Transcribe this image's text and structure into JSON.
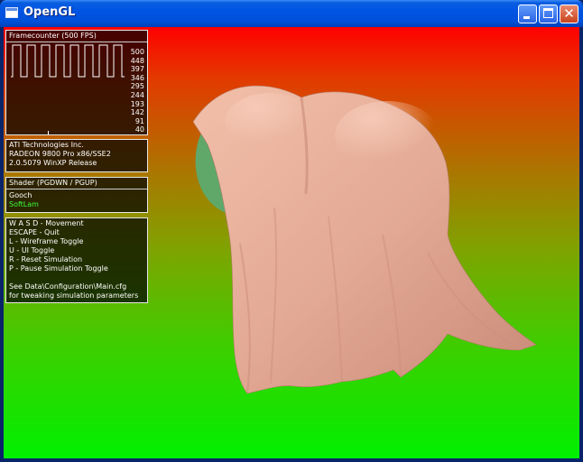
{
  "window": {
    "title": "OpenGL",
    "buttons": {
      "minimize": "minimize",
      "maximize": "maximize",
      "close": "✕"
    }
  },
  "framecounter": {
    "header": "Framecounter (500 FPS)",
    "scale": [
      "500",
      "448",
      "397",
      "346",
      "295",
      "244",
      "193",
      "142",
      "91",
      "40"
    ]
  },
  "gpu_info": {
    "lines": [
      "ATI Technologies Inc.",
      "RADEON 9800 Pro x86/SSE2",
      "2.0.5079 WinXP Release"
    ]
  },
  "shader": {
    "header": "Shader (PGDWN / PGUP)",
    "options": [
      "Gooch",
      "SoftLam"
    ],
    "selected": "SoftLam"
  },
  "help": {
    "lines": [
      "W A S D - Movement",
      "ESCAPE - Quit",
      "L - Wireframe Toggle",
      "U - UI Toggle",
      "R - Reset Simulation",
      "P - Pause Simulation Toggle"
    ],
    "note": [
      "See Data\\Configuration\\Main.cfg",
      "for tweaking simulation parameters"
    ]
  },
  "colors": {
    "background_top": "#ff0000",
    "background_bottom": "#00f000",
    "cloth": "#e3aa95",
    "sphere": "#5fa86a",
    "selected_shader": "#3aff3a"
  }
}
